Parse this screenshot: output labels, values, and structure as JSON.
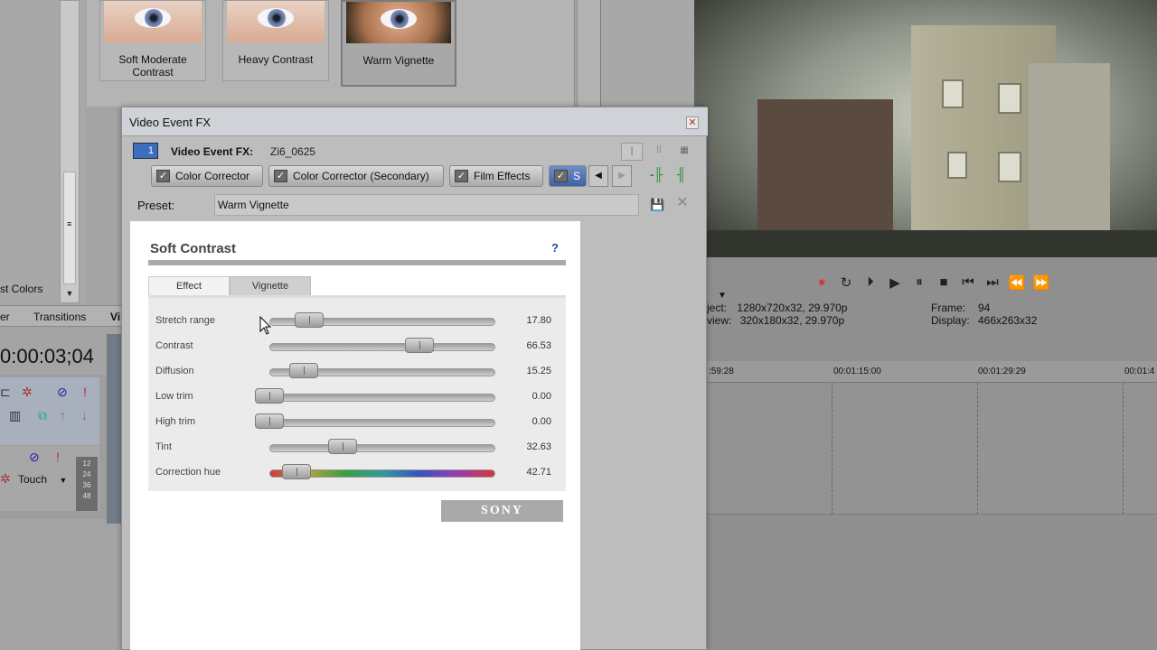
{
  "browser": {
    "presets": [
      {
        "label": "Soft Moderate Contrast"
      },
      {
        "label": "Heavy Contrast"
      },
      {
        "label": "Warm Vignette"
      }
    ],
    "colors_label": "st Colors",
    "tabs": {
      "left": "er",
      "transitions": "Transitions",
      "video": "Vi"
    }
  },
  "timeline": {
    "timecode": "0:00:03;04",
    "touch_label": "Touch",
    "meter_ticks": [
      "12",
      "24",
      "36",
      "48"
    ],
    "ruler_ticks": [
      ":59:28",
      "00:01:15:00",
      "00:01:29:29",
      "00:01:4"
    ]
  },
  "preview": {
    "project_label": "ject:",
    "project_value": "1280x720x32, 29.970p",
    "preview_label": "view:",
    "preview_value": "320x180x32, 29.970p",
    "frame_label": "Frame:",
    "frame_value": "94",
    "display_label": "Display:",
    "display_value": "466x263x32"
  },
  "dialog": {
    "title": "Video Event FX",
    "close_glyph": "✕",
    "chain_badge": "1",
    "chain_label": "Video Event FX:",
    "chain_name": "Zi6_0625",
    "plugins": [
      "Color Corrector",
      "Color Corrector (Secondary)",
      "Film Effects",
      "S"
    ],
    "preset_label": "Preset:",
    "preset_value": "Warm Vignette"
  },
  "panel": {
    "title": "Soft Contrast",
    "help": "?",
    "tabs": [
      "Effect",
      "Vignette"
    ],
    "sliders": [
      {
        "label": "Stretch range",
        "value": "17.80"
      },
      {
        "label": "Contrast",
        "value": "66.53"
      },
      {
        "label": "Diffusion",
        "value": "15.25"
      },
      {
        "label": "Low trim",
        "value": "0.00"
      },
      {
        "label": "High trim",
        "value": "0.00"
      },
      {
        "label": "Tint",
        "value": "32.63"
      },
      {
        "label": "Correction hue",
        "value": "42.71"
      }
    ],
    "brand": "SONY"
  },
  "colors": {
    "accent": "#3f62a8",
    "record": "#d33a3a"
  }
}
